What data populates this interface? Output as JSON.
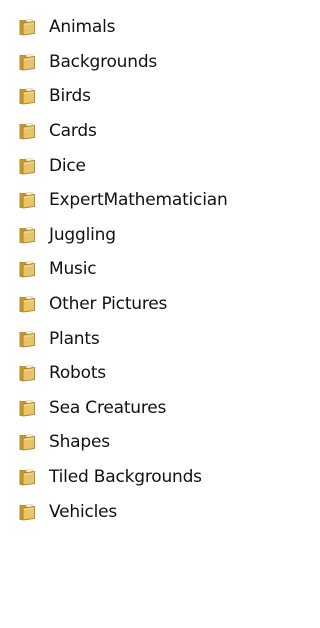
{
  "colors": {
    "folder_body": "#e8c36a",
    "folder_back": "#c99a2e",
    "folder_edge": "#a87a1a",
    "folder_paper": "#fbf3dc",
    "text": "#111111",
    "background": "#ffffff"
  },
  "folders": [
    {
      "label": "Animals",
      "icon": "folder-icon"
    },
    {
      "label": "Backgrounds",
      "icon": "folder-icon"
    },
    {
      "label": "Birds",
      "icon": "folder-icon"
    },
    {
      "label": "Cards",
      "icon": "folder-icon"
    },
    {
      "label": "Dice",
      "icon": "folder-icon"
    },
    {
      "label": "ExpertMathematician",
      "icon": "folder-icon"
    },
    {
      "label": "Juggling",
      "icon": "folder-icon"
    },
    {
      "label": "Music",
      "icon": "folder-icon"
    },
    {
      "label": "Other Pictures",
      "icon": "folder-icon"
    },
    {
      "label": "Plants",
      "icon": "folder-icon"
    },
    {
      "label": "Robots",
      "icon": "folder-icon"
    },
    {
      "label": "Sea Creatures",
      "icon": "folder-icon"
    },
    {
      "label": "Shapes",
      "icon": "folder-icon"
    },
    {
      "label": "Tiled Backgrounds",
      "icon": "folder-icon"
    },
    {
      "label": "Vehicles",
      "icon": "folder-icon"
    }
  ]
}
